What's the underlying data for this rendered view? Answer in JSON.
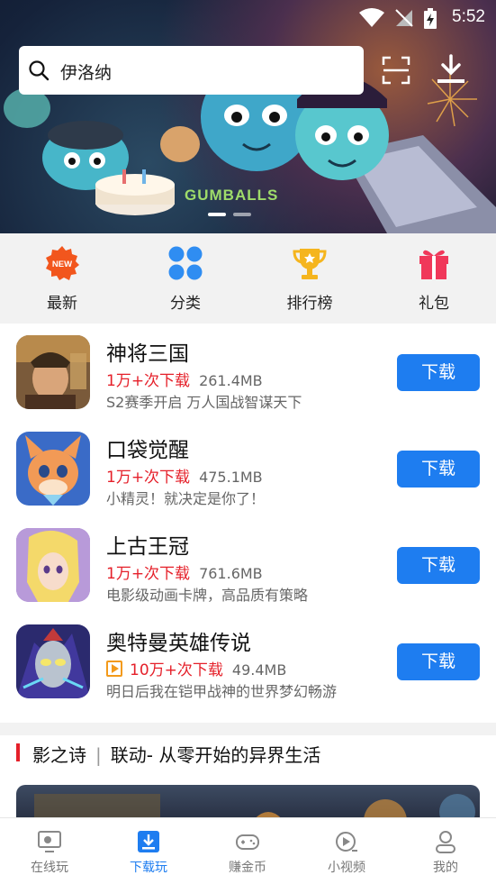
{
  "status_bar": {
    "time": "5:52"
  },
  "search": {
    "query": "伊洛纳"
  },
  "banner": {
    "logo_text": "GUMBALLS",
    "dots": 2,
    "active_dot": 0
  },
  "categories": [
    {
      "label": "最新",
      "icon": "new-badge-icon",
      "badge": "NEW"
    },
    {
      "label": "分类",
      "icon": "grid-icon"
    },
    {
      "label": "排行榜",
      "icon": "trophy-icon"
    },
    {
      "label": "礼包",
      "icon": "gift-icon"
    }
  ],
  "games": [
    {
      "name": "神将三国",
      "downloads": "1万+次下载",
      "size": "261.4MB",
      "desc": "S2赛季开启 万人国战智谋天下",
      "button": "下载",
      "has_video": false
    },
    {
      "name": "口袋觉醒",
      "downloads": "1万+次下载",
      "size": "475.1MB",
      "desc": "小精灵！就决定是你了！",
      "button": "下载",
      "has_video": false
    },
    {
      "name": "上古王冠",
      "downloads": "1万+次下载",
      "size": "761.6MB",
      "desc": "电影级动画卡牌，高品质有策略",
      "button": "下载",
      "has_video": false
    },
    {
      "name": "奥特曼英雄传说",
      "downloads": "10万+次下载",
      "size": "49.4MB",
      "desc": "明日后我在铠甲战神的世界梦幻畅游",
      "button": "下载",
      "has_video": true
    }
  ],
  "section": {
    "tag": "影之诗",
    "separator": "|",
    "title": "联动- 从零开始的异界生活"
  },
  "nav": [
    {
      "label": "在线玩",
      "icon": "online-play-icon"
    },
    {
      "label": "下载玩",
      "icon": "download-play-icon"
    },
    {
      "label": "赚金币",
      "icon": "gamepad-icon"
    },
    {
      "label": "小视频",
      "icon": "video-icon"
    },
    {
      "label": "我的",
      "icon": "profile-icon"
    }
  ],
  "active_nav": 1,
  "colors": {
    "accent": "#1e7df0",
    "download_count": "#e5202a",
    "video_badge": "#f39a1a"
  }
}
